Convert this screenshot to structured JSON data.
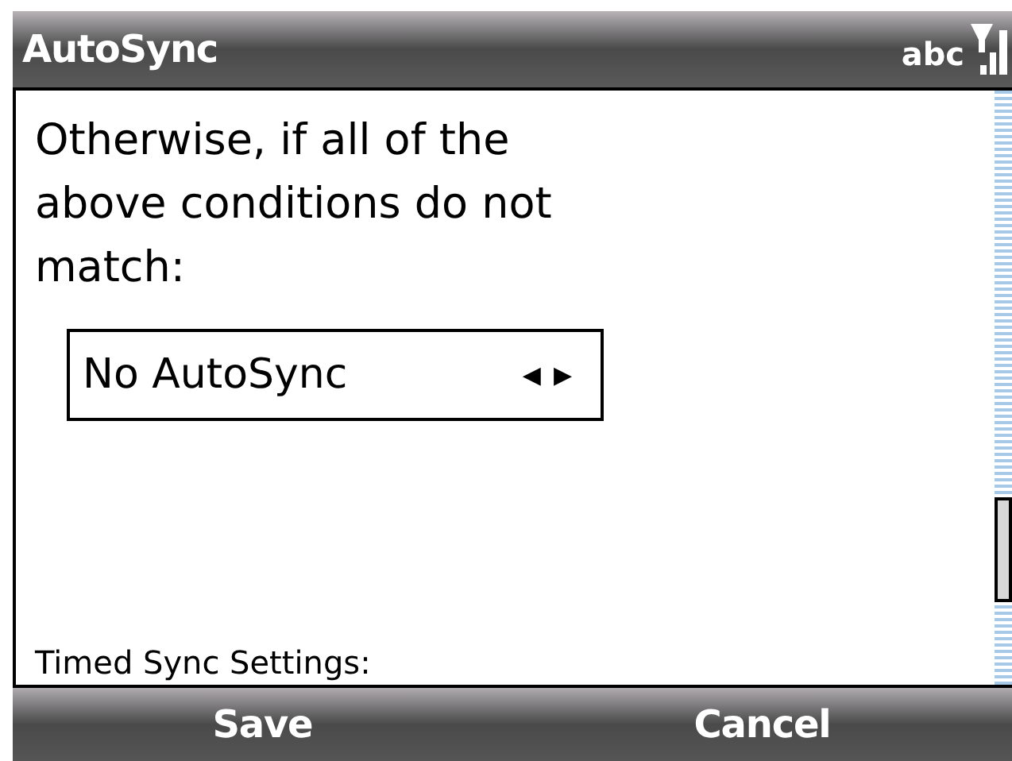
{
  "window": {
    "title": "AutoSync",
    "input_mode": "abc"
  },
  "content": {
    "prompt": "Otherwise, if all of the above conditions do not match:",
    "spinner": {
      "value": "No AutoSync",
      "left": "◀",
      "right": "▶"
    },
    "next_heading": "Timed Sync Settings:"
  },
  "softkeys": [
    {
      "label": "Save"
    },
    {
      "label": "Cancel"
    }
  ]
}
